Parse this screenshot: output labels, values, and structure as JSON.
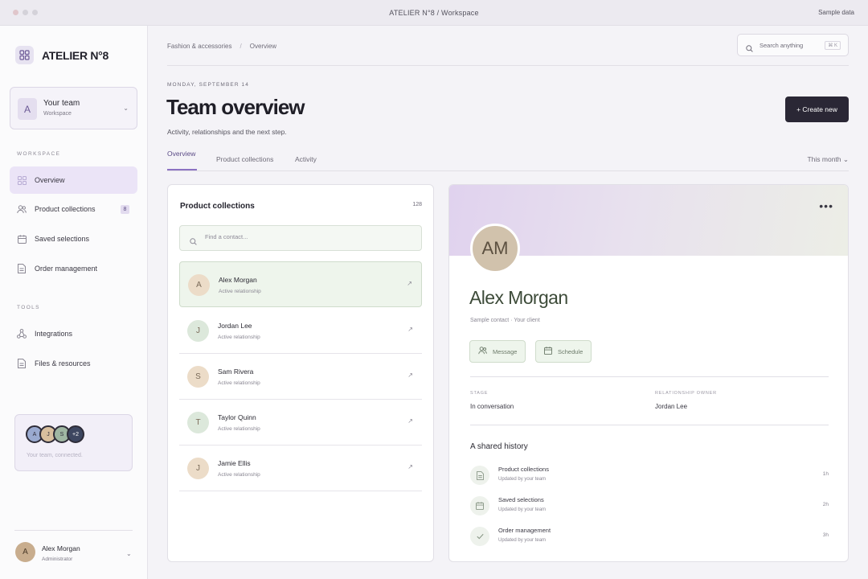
{
  "window": {
    "title": "ATELIER N°8 / Workspace",
    "sample_label": "Sample data"
  },
  "sidebar": {
    "brand": "ATELIER N°8",
    "team": {
      "initial": "A",
      "name": "Your team",
      "sub": "Workspace"
    },
    "section_workspace": "WORKSPACE",
    "section_tools": "TOOLS",
    "items": [
      {
        "label": "Overview",
        "icon": "grid-icon",
        "active": true
      },
      {
        "label": "Product collections",
        "icon": "users-icon",
        "badge": "8"
      },
      {
        "label": "Saved selections",
        "icon": "calendar-icon"
      },
      {
        "label": "Order management",
        "icon": "document-icon"
      }
    ],
    "tools": [
      {
        "label": "Integrations",
        "icon": "integrations-icon"
      },
      {
        "label": "Files & resources",
        "icon": "file-icon"
      }
    ],
    "team_card": {
      "avatars": [
        "A",
        "J",
        "S",
        "+2"
      ],
      "text": "Your team, connected."
    },
    "profile": {
      "initial": "A",
      "name": "Alex Morgan",
      "role": "Administrator"
    }
  },
  "header": {
    "breadcrumb": [
      "Fashion & accessories",
      "Overview"
    ],
    "search": {
      "placeholder": "Search anything",
      "shortcut": "⌘ K"
    },
    "date": "MONDAY, SEPTEMBER 14",
    "title": "Team overview",
    "subtitle": "Activity, relationships and the next step.",
    "create_label": "+ Create new"
  },
  "tabs": {
    "items": [
      "Overview",
      "Product collections",
      "Activity"
    ],
    "period": "This month ⌄"
  },
  "collections": {
    "title": "Product collections",
    "count": "128",
    "search_placeholder": "Find a contact...",
    "contacts": [
      {
        "initial": "A",
        "name": "Alex Morgan",
        "sub": "Active relationship",
        "color": "#ecdcc8"
      },
      {
        "initial": "J",
        "name": "Jordan Lee",
        "sub": "Active relationship",
        "color": "#dce8db"
      },
      {
        "initial": "S",
        "name": "Sam Rivera",
        "sub": "Active relationship",
        "color": "#ecdcc8"
      },
      {
        "initial": "T",
        "name": "Taylor Quinn",
        "sub": "Active relationship",
        "color": "#dce8db"
      },
      {
        "initial": "J",
        "name": "Jamie Ellis",
        "sub": "Active relationship",
        "color": "#ecdcc8"
      }
    ]
  },
  "detail": {
    "initials": "AM",
    "name": "Alex Morgan",
    "sub": "Sample contact · Your client",
    "message_label": "Message",
    "schedule_label": "Schedule",
    "stage_label": "STAGE",
    "stage_value": "In conversation",
    "owner_label": "RELATIONSHIP OWNER",
    "owner_value": "Jordan Lee",
    "history_title": "A shared history",
    "history": [
      {
        "name": "Product collections",
        "sub": "Updated by your team",
        "time": "1h",
        "icon": "document-icon"
      },
      {
        "name": "Saved selections",
        "sub": "Updated by your team",
        "time": "2h",
        "icon": "calendar-icon"
      },
      {
        "name": "Order management",
        "sub": "Updated by your team",
        "time": "3h",
        "icon": "check-icon"
      }
    ]
  },
  "colors": {
    "accent": "#8c72c2",
    "dark": "#2a2735",
    "green_tint": "#eef5ec"
  }
}
